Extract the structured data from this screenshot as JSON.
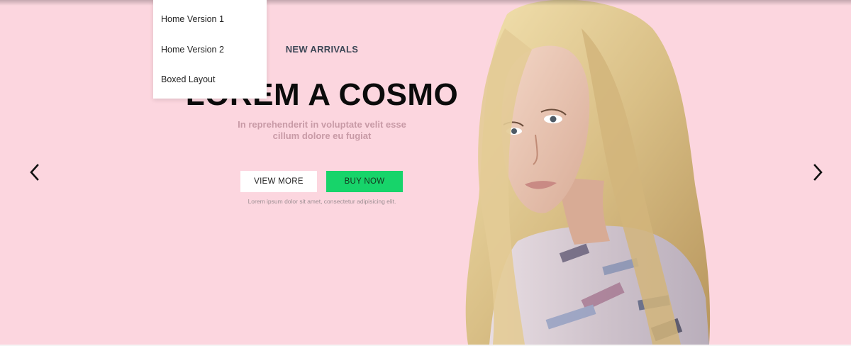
{
  "menu": {
    "items": [
      {
        "label": "Home Version 1"
      },
      {
        "label": "Home Version 2"
      },
      {
        "label": "Boxed Layout"
      }
    ]
  },
  "slide": {
    "kicker": "NEW ARRIVALS",
    "headline": "LOREM A COSMO",
    "subtext_line1": "In reprehenderit in voluptate velit esse",
    "subtext_line2": "cillum dolore eu fugiat",
    "view_more_label": "VIEW MORE",
    "buy_now_label": "BUY NOW",
    "caption": "Lorem ipsum dolor sit amet, consectetur adipisicing elit."
  },
  "nav": {
    "prev_icon": "chevron-left-icon",
    "next_icon": "chevron-right-icon"
  },
  "colors": {
    "background": "#fcd6df",
    "accent_green": "#17d46a",
    "headline": "#0b0b0b",
    "kicker": "#3d4756",
    "subtext": "#c89aa6"
  }
}
